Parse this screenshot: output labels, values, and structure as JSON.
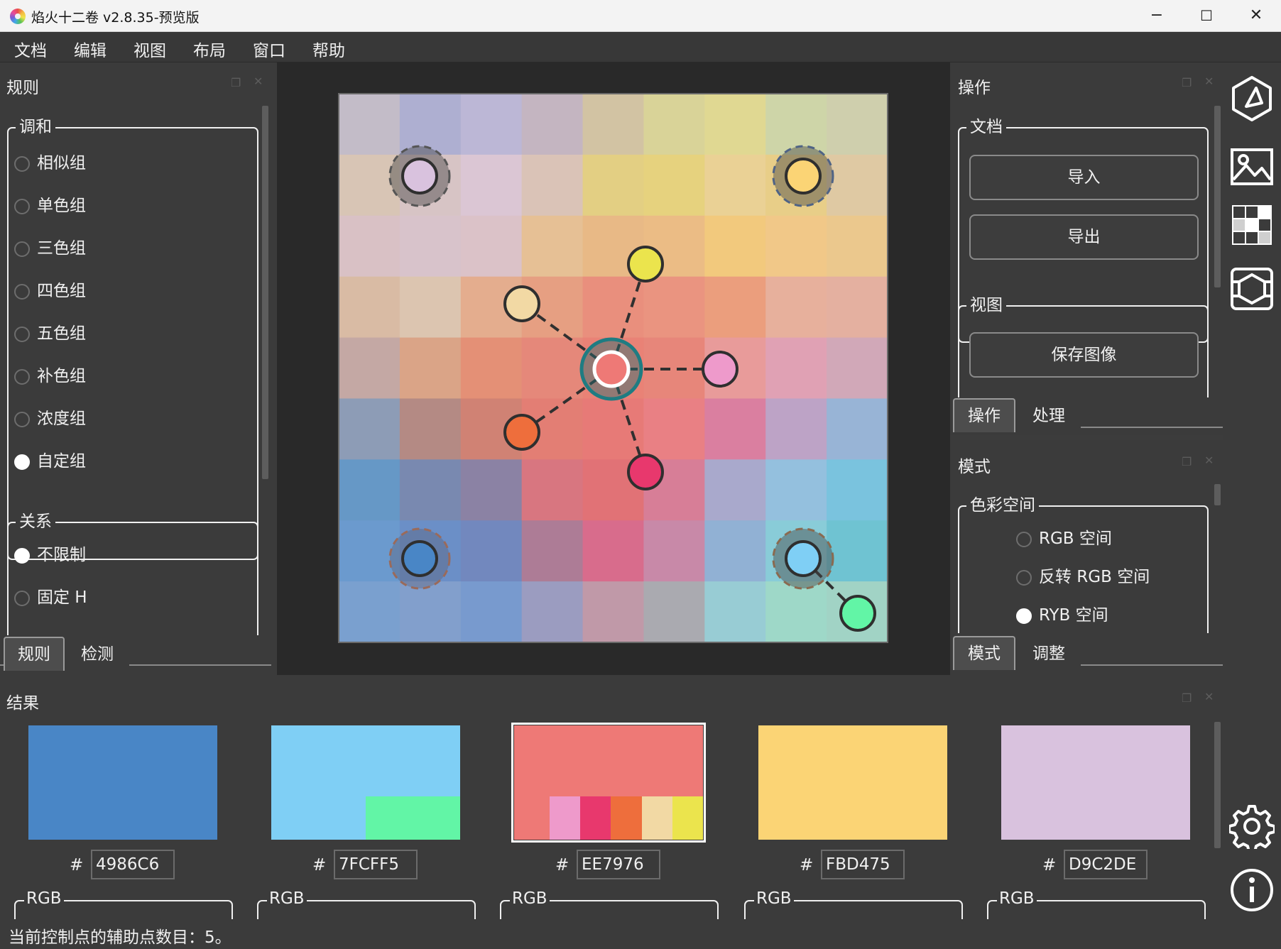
{
  "window": {
    "title": "焰火十二卷 v2.8.35-预览版",
    "minimize": "−",
    "maximize": "☐",
    "close": "✕"
  },
  "menu": [
    "文档",
    "编辑",
    "视图",
    "布局",
    "窗口",
    "帮助"
  ],
  "rules_panel": {
    "title": "规则",
    "harmony": {
      "title": "调和",
      "options": [
        "相似组",
        "单色组",
        "三色组",
        "四色组",
        "五色组",
        "补色组",
        "浓度组",
        "自定组"
      ],
      "selected": "自定组"
    },
    "relation": {
      "title": "关系",
      "options": [
        "不限制",
        "固定 H"
      ],
      "selected": "不限制"
    },
    "tabs": [
      "规则",
      "检测"
    ],
    "active_tab": "规则"
  },
  "operations_panel": {
    "title": "操作",
    "document": {
      "title": "文档",
      "import": "导入",
      "export": "导出"
    },
    "view": {
      "title": "视图",
      "save_image": "保存图像"
    },
    "tabs": [
      "操作",
      "处理"
    ],
    "active_tab": "操作"
  },
  "mode_panel": {
    "title": "模式",
    "color_space": {
      "title": "色彩空间",
      "options": [
        "RGB 空间",
        "反转 RGB 空间",
        "RYB 空间"
      ],
      "selected": "RYB 空间"
    },
    "tabs": [
      "模式",
      "调整"
    ],
    "active_tab": "模式"
  },
  "result_panel": {
    "title": "结果",
    "swatches": [
      {
        "hex": "4986C6",
        "color": "#4986c6",
        "selected": false,
        "sub_colors": []
      },
      {
        "hex": "7FCFF5",
        "color": "#7fcff5",
        "selected": false,
        "sub_colors": [
          "#62f5a6"
        ]
      },
      {
        "hex": "EE7976",
        "color": "#ee7976",
        "selected": true,
        "sub_colors": [
          "#ee9acb",
          "#e8386d",
          "#ee6e3c",
          "#f2d9a4",
          "#ebe44d"
        ]
      },
      {
        "hex": "FBD475",
        "color": "#fbd475",
        "selected": false,
        "sub_colors": []
      },
      {
        "hex": "D9C2DE",
        "color": "#d9c2de",
        "selected": false,
        "sub_colors": []
      }
    ],
    "hash_label": "#",
    "rgb_label": "RGB"
  },
  "status": "当前控制点的辅助点数目：5。",
  "side_icons": [
    "triangle-icon",
    "image-icon",
    "grid-icon",
    "cube-icon",
    "gear-icon",
    "info-icon"
  ],
  "colors": {
    "grid": [
      [
        "#c3bcc8",
        "#aeafd1",
        "#bcb7d6",
        "#c4b5c1",
        "#d2c3a3",
        "#d9d398",
        "#e0d892",
        "#ced5a8",
        "#cfcfad"
      ],
      [
        "#d8c5b5",
        "#d7c4c5",
        "#dbc6d4",
        "#dac3b7",
        "#e3cf83",
        "#e6d27e",
        "#ead195",
        "#e8ce88",
        "#dfc9a3"
      ],
      [
        "#d9c1c5",
        "#d8c3cb",
        "#dbc2c8",
        "#e6c095",
        "#e8b986",
        "#ebbc85",
        "#f2c97d",
        "#f1c888",
        "#ebc88d"
      ],
      [
        "#d9bba4",
        "#dcc5b0",
        "#e4ad8e",
        "#e69f82",
        "#e98f7d",
        "#ea9480",
        "#eb9e7d",
        "#e7b09c",
        "#e4b0a0"
      ],
      [
        "#c4a8a4",
        "#daa487",
        "#e49076",
        "#e5887a",
        "#e98276",
        "#e7867a",
        "#e89b9a",
        "#e0a1b4",
        "#d1a8b8"
      ],
      [
        "#8d9cb6",
        "#b48a84",
        "#d08274",
        "#e37e74",
        "#e77a77",
        "#e98084",
        "#da7fa0",
        "#bda3c6",
        "#98b4d6"
      ],
      [
        "#6698c6",
        "#7989b0",
        "#8b82a4",
        "#d87680",
        "#e17276",
        "#d77e97",
        "#a9a9cc",
        "#94c0de",
        "#7ac3de"
      ],
      [
        "#6b9ace",
        "#6b8fc7",
        "#7288be",
        "#ad7c96",
        "#d86c8c",
        "#c889a8",
        "#91b1d4",
        "#89ccd8",
        "#6fc3d2"
      ],
      [
        "#7aa0cf",
        "#829fcc",
        "#789ace",
        "#9b9cc0",
        "#c099a8",
        "#aaaab0",
        "#98ccd4",
        "#9ed8c8",
        "#a1d3c5"
      ]
    ],
    "accent_ring": "#1f7c82"
  }
}
